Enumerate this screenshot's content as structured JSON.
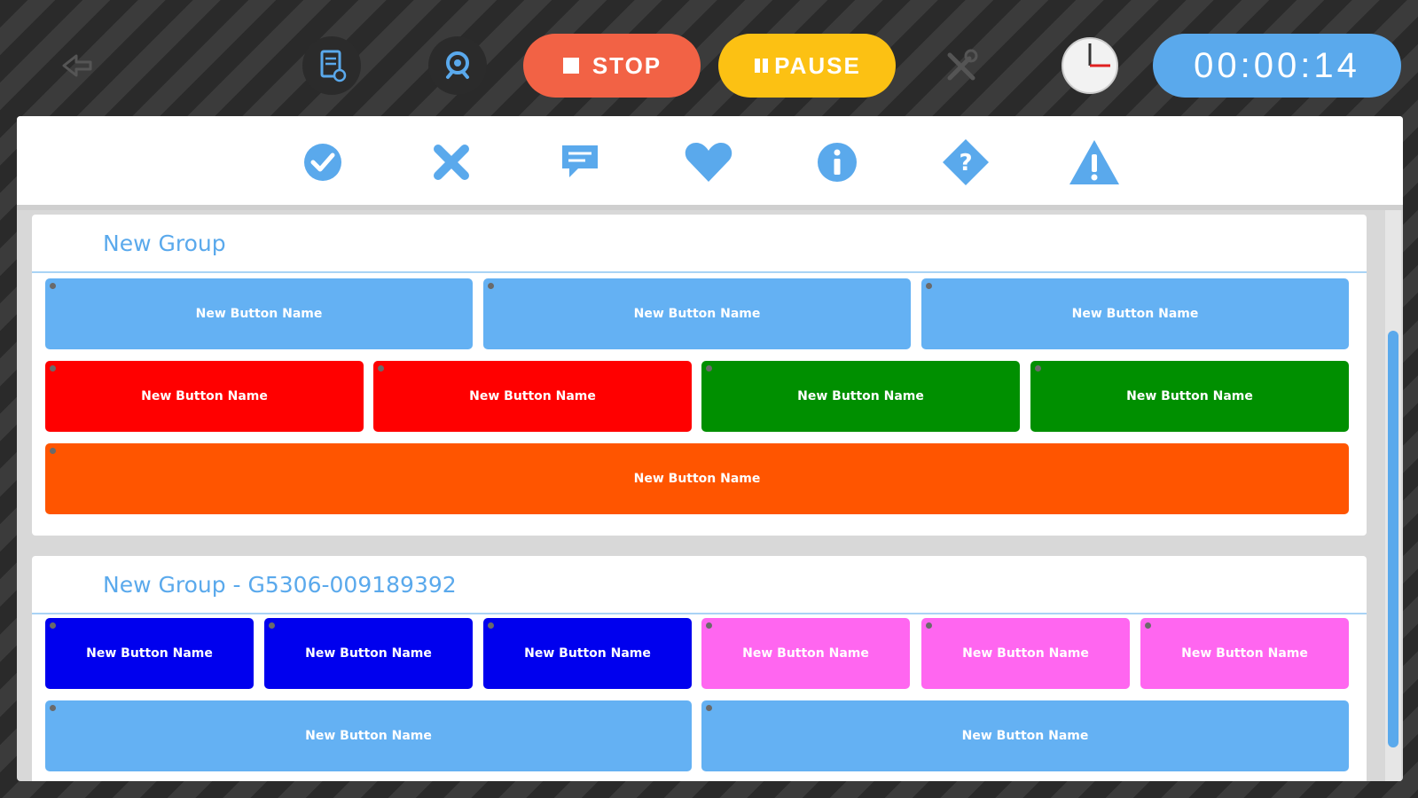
{
  "toolbar": {
    "stop_label": "STOP",
    "pause_label": "PAUSE",
    "timer": "00:00:14",
    "icons": [
      "back-arrow-icon",
      "document-icon",
      "webcam-icon",
      "stop-square-icon",
      "pause-bars-icon",
      "tools-icon",
      "clock-icon"
    ]
  },
  "iconbar": {
    "icons": [
      "check-circle-icon",
      "close-x-icon",
      "comment-icon",
      "heart-icon",
      "info-icon",
      "help-icon",
      "warning-icon"
    ]
  },
  "groups": [
    {
      "title": "New Group",
      "buttons": [
        {
          "label": "New Button Name",
          "color": "#64b1f3"
        },
        {
          "label": "New Button Name",
          "color": "#64b1f3"
        },
        {
          "label": "New Button Name",
          "color": "#64b1f3"
        },
        {
          "label": "New Button Name",
          "color": "#ff0000"
        },
        {
          "label": "New Button Name",
          "color": "#ff0000"
        },
        {
          "label": "New Button Name",
          "color": "#008f00"
        },
        {
          "label": "New Button Name",
          "color": "#008f00"
        },
        {
          "label": "New Button Name",
          "color": "#ff5500"
        }
      ]
    },
    {
      "title": "New Group - G5306-009189392",
      "buttons": [
        {
          "label": "New Button Name",
          "color": "#0000ee"
        },
        {
          "label": "New Button Name",
          "color": "#0000ee"
        },
        {
          "label": "New Button Name",
          "color": "#0000ee"
        },
        {
          "label": "New Button Name",
          "color": "#ff66f0"
        },
        {
          "label": "New Button Name",
          "color": "#ff66f0"
        },
        {
          "label": "New Button Name",
          "color": "#ff66f0"
        },
        {
          "label": "New Button Name",
          "color": "#64b1f3"
        },
        {
          "label": "New Button Name",
          "color": "#64b1f3"
        }
      ]
    }
  ],
  "colors": {
    "accent": "#5aa9ec",
    "stop": "#f26245",
    "pause": "#fcc113"
  }
}
